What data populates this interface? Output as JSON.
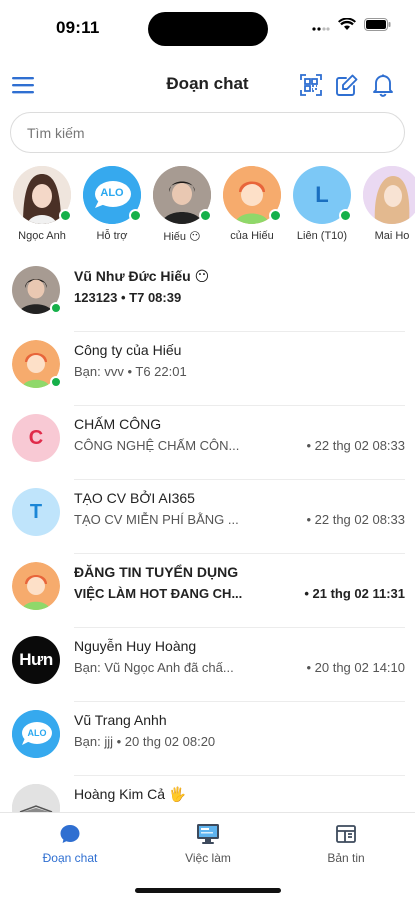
{
  "status": {
    "time": "09:11"
  },
  "header": {
    "title": "Đoạn chat"
  },
  "search": {
    "placeholder": "Tìm kiếm"
  },
  "stories": [
    {
      "name": "Ngọc Anh",
      "online": true
    },
    {
      "name": "Hỗ trợ",
      "online": true,
      "logo_text": "ALO"
    },
    {
      "name": "Hiếu 😶",
      "online": true
    },
    {
      "name": "của Hiếu",
      "online": true
    },
    {
      "name": "Liên (T10)",
      "online": true,
      "letter": "L"
    },
    {
      "name": "Mai Ho"
    }
  ],
  "chats": [
    {
      "name": "Vũ Như Đức Hiếu 😶",
      "preview": "123123 • T7 08:39",
      "time": "",
      "unread": true,
      "online": true
    },
    {
      "name": "Công ty của Hiếu",
      "preview": "Bạn: vvv • T6 22:01",
      "time": "",
      "unread": false,
      "online": true
    },
    {
      "name": "CHẤM CÔNG",
      "preview": "CÔNG NGHỆ CHẤM CÔN...",
      "time": "• 22 thg 02 08:33",
      "unread": false,
      "letter": "C"
    },
    {
      "name": "TẠO CV BỞI AI365",
      "preview": "TẠO CV MIỄN PHÍ BẰNG ...",
      "time": "• 22 thg 02 08:33",
      "unread": false,
      "letter": "T"
    },
    {
      "name": "ĐĂNG TIN TUYỂN DỤNG",
      "preview": "VIỆC LÀM HOT ĐANG CH...",
      "time": "• 21 thg 02 11:31",
      "unread": true
    },
    {
      "name": "Nguyễn Huy Hoàng",
      "preview": "Bạn: Vũ Ngọc Anh đã chấ...",
      "time": "• 20 thg 02 14:10",
      "unread": false,
      "logo_text": "Hưn"
    },
    {
      "name": "Vũ Trang Anhh",
      "preview": "Bạn: jjj • 20 thg 02 08:20",
      "time": "",
      "unread": false,
      "logo_text": "ALO"
    },
    {
      "name": "Hoàng Kim Cả 🖐",
      "preview": "",
      "time": "",
      "unread": false
    }
  ],
  "tabs": [
    {
      "label": "Đoạn chat",
      "active": true
    },
    {
      "label": "Việc làm",
      "active": false
    },
    {
      "label": "Bản tin",
      "active": false
    }
  ],
  "colors": {
    "accent": "#2f6fd1",
    "online": "#16b04a",
    "letter_c_bg": "#f8c9d4",
    "letter_c_fg": "#e02b4a",
    "letter_t_bg": "#bfe4fb",
    "letter_t_fg": "#1b86d6",
    "letter_l_bg": "#7cc8f6",
    "letter_l_fg": "#1a6fc0"
  }
}
